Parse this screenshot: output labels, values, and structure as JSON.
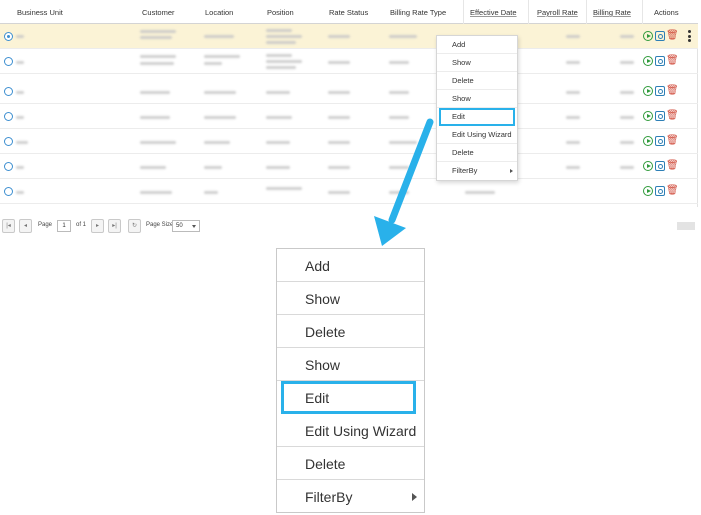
{
  "grid": {
    "columns": [
      "Business Unit",
      "Customer",
      "Location",
      "Position",
      "Rate Status",
      "Billing Rate Type",
      "Effective Date",
      "Payroll Rate",
      "Billing Rate",
      "Actions"
    ],
    "rows": [
      {
        "selected": true
      },
      {
        "selected": false
      },
      {
        "selected": false
      },
      {
        "selected": false
      },
      {
        "selected": false
      },
      {
        "selected": false
      },
      {
        "selected": false
      }
    ]
  },
  "context_menu": {
    "items": [
      "Add",
      "Show",
      "Delete",
      "Show",
      "Edit",
      "Edit Using Wizard",
      "Delete",
      "FilterBy"
    ],
    "highlighted_index": 4,
    "submenu_index": 7
  },
  "pager": {
    "page_label": "Page",
    "page_value": "1",
    "of_label": "of 1",
    "page_size_label": "Page Size",
    "page_size_value": "50"
  },
  "colors": {
    "highlight": "#29b1ea",
    "selected_row": "#fbf3d6",
    "radio": "#3d8fd0",
    "callout_arrow": "#29b1ea"
  }
}
